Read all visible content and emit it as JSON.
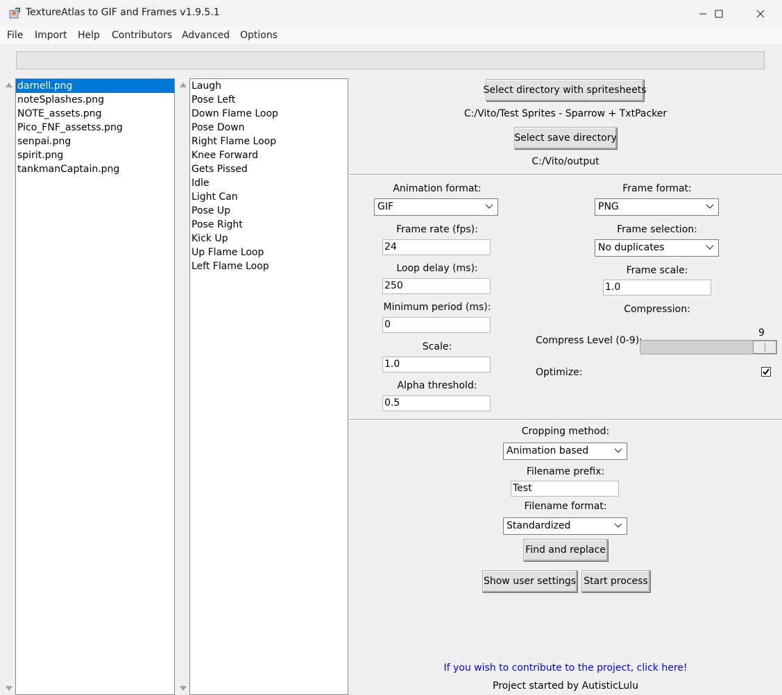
{
  "window": {
    "title": "TextureAtlas to GIF and Frames v1.9.5.1"
  },
  "menu": [
    "File",
    "Import",
    "Help",
    "Contributors",
    "Advanced",
    "Options"
  ],
  "spritesheets": {
    "items": [
      "darnell.png",
      "noteSplashes.png",
      "NOTE_assets.png",
      "Pico_FNF_assetss.png",
      "senpai.png",
      "spirit.png",
      "tankmanCaptain.png"
    ],
    "selected": "darnell.png"
  },
  "animations": {
    "items": [
      "Laugh",
      "Pose Left",
      "Down Flame Loop",
      "Pose Down",
      "Right Flame Loop",
      "Knee Forward",
      "Gets Pissed",
      "Idle",
      "Light Can",
      "Pose Up",
      "Pose Right",
      "Kick Up",
      "Up Flame Loop",
      "Left Flame Loop"
    ]
  },
  "directories": {
    "select_input_button": "Select directory with spritesheets",
    "input_path": "C:/Vito/Test Sprites - Sparrow + TxtPacker",
    "select_output_button": "Select save directory",
    "output_path": "C:/Vito/output"
  },
  "animation_settings": {
    "format_label": "Animation format:",
    "format_value": "GIF",
    "fps_label": "Frame rate (fps):",
    "fps_value": "24",
    "loop_delay_label": "Loop delay (ms):",
    "loop_delay_value": "250",
    "min_period_label": "Minimum period (ms):",
    "min_period_value": "0",
    "scale_label": "Scale:",
    "scale_value": "1.0",
    "alpha_label": "Alpha threshold:",
    "alpha_value": "0.5"
  },
  "frame_settings": {
    "format_label": "Frame format:",
    "format_value": "PNG",
    "selection_label": "Frame selection:",
    "selection_value": "No duplicates",
    "scale_label": "Frame scale:",
    "scale_value": "1.0",
    "compression_label": "Compression:",
    "compress_level_label": "Compress Level (0-9):",
    "compress_level_value": "9",
    "compress_level_fraction": 1.0,
    "optimize_label": "Optimize:",
    "optimize_checked": true
  },
  "output_settings": {
    "cropping_label": "Cropping method:",
    "cropping_value": "Animation based",
    "prefix_label": "Filename prefix:",
    "prefix_value": "Test",
    "filename_format_label": "Filename format:",
    "filename_format_value": "Standardized",
    "find_replace_button": "Find and replace",
    "show_settings_button": "Show user settings",
    "start_button": "Start process"
  },
  "footer": {
    "contribute_link": "If you wish to contribute to the project, click here!",
    "credit": "Project started by AutisticLulu"
  },
  "colors": {
    "selection": "#0078d7",
    "link": "#0000ff",
    "background": "#f0f0f0"
  }
}
